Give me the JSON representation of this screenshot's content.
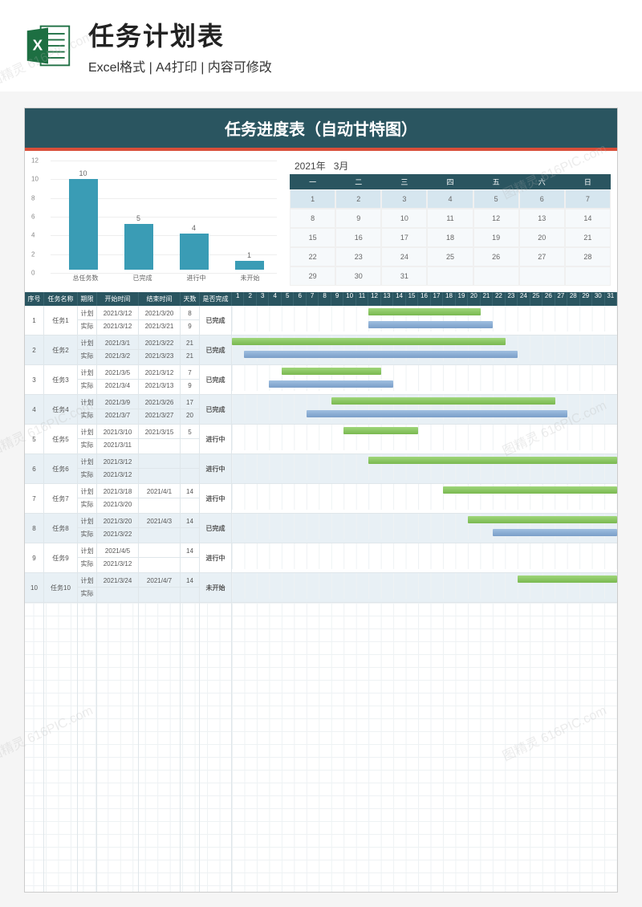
{
  "header": {
    "title": "任务计划表",
    "subtitle": "Excel格式 | A4打印 | 内容可修改"
  },
  "sheet_title": "任务进度表（自动甘特图）",
  "chart_data": {
    "type": "bar",
    "title": "",
    "xlabel": "",
    "ylabel": "",
    "ylim": [
      0,
      12
    ],
    "ticks": [
      0,
      2,
      4,
      6,
      8,
      10,
      12
    ],
    "categories": [
      "总任务数",
      "已完成",
      "进行中",
      "未开始"
    ],
    "values": [
      10,
      5,
      4,
      1
    ]
  },
  "calendar": {
    "year": "2021年",
    "month": "3月",
    "dow": [
      "一",
      "二",
      "三",
      "四",
      "五",
      "六",
      "日"
    ],
    "cells": [
      1,
      2,
      3,
      4,
      5,
      6,
      7,
      8,
      9,
      10,
      11,
      12,
      13,
      14,
      15,
      16,
      17,
      18,
      19,
      20,
      21,
      22,
      23,
      24,
      25,
      26,
      27,
      28,
      29,
      30,
      31,
      "",
      "",
      "",
      " "
    ]
  },
  "columns": {
    "c1": "序号",
    "c2": "任务名称",
    "c3": "期限",
    "c4": "开始时间",
    "c5": "结束时间",
    "c6": "天数",
    "c7": "是否完成"
  },
  "row_types": {
    "plan": "计划",
    "actual": "实际"
  },
  "statuses": {
    "done": "已完成",
    "prog": "进行中",
    "ns": "未开始"
  },
  "days": 31,
  "tasks": [
    {
      "no": "1",
      "name": "任务1",
      "status": "done",
      "plan": {
        "start": "2021/3/12",
        "end": "2021/3/20",
        "days": "8",
        "s": 12,
        "e": 20
      },
      "act": {
        "start": "2021/3/12",
        "end": "2021/3/21",
        "days": "9",
        "s": 12,
        "e": 21
      }
    },
    {
      "no": "2",
      "name": "任务2",
      "status": "done",
      "plan": {
        "start": "2021/3/1",
        "end": "2021/3/22",
        "days": "21",
        "s": 1,
        "e": 22
      },
      "act": {
        "start": "2021/3/2",
        "end": "2021/3/23",
        "days": "21",
        "s": 2,
        "e": 23
      }
    },
    {
      "no": "3",
      "name": "任务3",
      "status": "done",
      "plan": {
        "start": "2021/3/5",
        "end": "2021/3/12",
        "days": "7",
        "s": 5,
        "e": 12
      },
      "act": {
        "start": "2021/3/4",
        "end": "2021/3/13",
        "days": "9",
        "s": 4,
        "e": 13
      }
    },
    {
      "no": "4",
      "name": "任务4",
      "status": "done",
      "plan": {
        "start": "2021/3/9",
        "end": "2021/3/26",
        "days": "17",
        "s": 9,
        "e": 26
      },
      "act": {
        "start": "2021/3/7",
        "end": "2021/3/27",
        "days": "20",
        "s": 7,
        "e": 27
      }
    },
    {
      "no": "5",
      "name": "任务5",
      "status": "prog",
      "plan": {
        "start": "2021/3/10",
        "end": "2021/3/15",
        "days": "5",
        "s": 10,
        "e": 15
      },
      "act": {
        "start": "2021/3/11",
        "end": "",
        "days": "",
        "s": 0,
        "e": 0
      }
    },
    {
      "no": "6",
      "name": "任务6",
      "status": "prog",
      "plan": {
        "start": "2021/3/12",
        "end": "",
        "days": "",
        "s": 12,
        "e": 31
      },
      "act": {
        "start": "2021/3/12",
        "end": "",
        "days": "",
        "s": 0,
        "e": 0
      }
    },
    {
      "no": "7",
      "name": "任务7",
      "status": "prog",
      "plan": {
        "start": "2021/3/18",
        "end": "2021/4/1",
        "days": "14",
        "s": 18,
        "e": 31
      },
      "act": {
        "start": "2021/3/20",
        "end": "",
        "days": "",
        "s": 0,
        "e": 0
      }
    },
    {
      "no": "8",
      "name": "任务8",
      "status": "done",
      "plan": {
        "start": "2021/3/20",
        "end": "2021/4/3",
        "days": "14",
        "s": 20,
        "e": 31
      },
      "act": {
        "start": "2021/3/22",
        "end": "",
        "days": "",
        "s": 22,
        "e": 31
      }
    },
    {
      "no": "9",
      "name": "任务9",
      "status": "prog",
      "plan": {
        "start": "2021/4/5",
        "end": "",
        "days": "14",
        "s": 0,
        "e": 0
      },
      "act": {
        "start": "2021/3/12",
        "end": "",
        "days": "",
        "s": 0,
        "e": 0
      }
    },
    {
      "no": "10",
      "name": "任务10",
      "status": "ns",
      "plan": {
        "start": "2021/3/24",
        "end": "2021/4/7",
        "days": "14",
        "s": 24,
        "e": 31
      },
      "act": {
        "start": "",
        "end": "",
        "days": "",
        "s": 0,
        "e": 0
      }
    }
  ],
  "watermark": "图精灵 616PIC.com"
}
